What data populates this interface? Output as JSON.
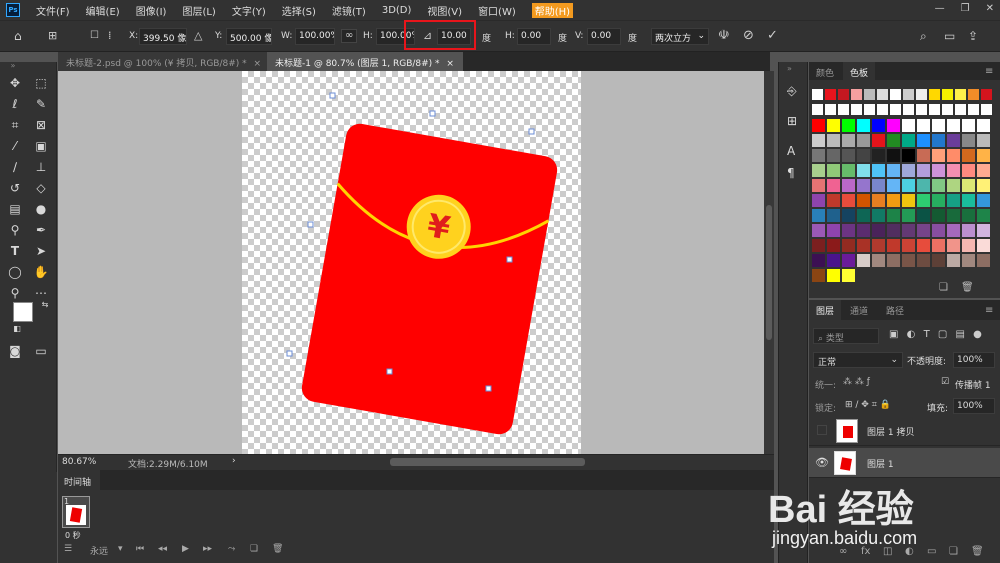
{
  "app": {
    "logo": "Ps"
  },
  "menu": [
    "文件(F)",
    "编辑(E)",
    "图像(I)",
    "图层(L)",
    "文字(Y)",
    "选择(S)",
    "滤镜(T)",
    "3D(D)",
    "视图(V)",
    "窗口(W)",
    "帮助(H)"
  ],
  "options": {
    "x_label": "X:",
    "x_value": "399.50 像素",
    "y_label": "Y:",
    "y_value": "500.00 像素",
    "w_label": "W:",
    "w_value": "100.00%",
    "h_label": "H:",
    "h_value": "100.00%",
    "angle_value": "10.00",
    "angle_unit": "度",
    "hskew_label": "H:",
    "hskew_value": "0.00",
    "hskew_unit": "度",
    "vskew_label": "V:",
    "vskew_value": "0.00",
    "vskew_unit": "度",
    "interp": "两次立方"
  },
  "tabs": [
    {
      "label": "未标题-2.psd @ 100% (¥ 拷贝, RGB/8#) *"
    },
    {
      "label": "未标题-1 @ 80.7% (图层 1, RGB/8#) *"
    }
  ],
  "status": {
    "zoom": "80.67%",
    "doc": "文档:2.29M/6.10M"
  },
  "timeline": {
    "title": "时间轴",
    "frame_num": "1",
    "frame_time": "0 秒",
    "loop": "永远"
  },
  "swatch_panel": {
    "tab_color": "颜色",
    "tab_swatch": "色板"
  },
  "layers_panel": {
    "tab_layers": "图层",
    "tab_channels": "通道",
    "tab_paths": "路径",
    "filter_kind": "类型",
    "blend_mode": "正常",
    "opacity_label": "不透明度:",
    "opacity": "100%",
    "unify_label": "统一:",
    "propagate_label": "传播帧 1",
    "lock_label": "锁定:",
    "fill_label": "填充:",
    "fill": "100%",
    "layers": [
      {
        "name": "图层 1 拷贝",
        "visible": false
      },
      {
        "name": "图层 1",
        "visible": true
      }
    ]
  },
  "envelope": {
    "symbol": "¥",
    "color": "#ff0000",
    "string_color": "#ffd400",
    "coin_color": "#ffd21e"
  },
  "watermark": {
    "logo": "Bai 经验",
    "url": "jingyan.baidu.com"
  }
}
